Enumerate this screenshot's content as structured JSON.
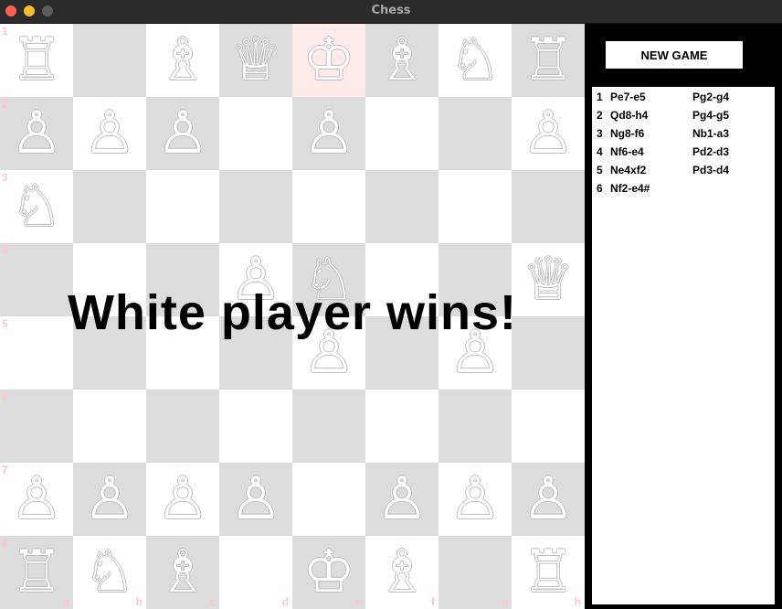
{
  "window": {
    "title": "Chess"
  },
  "board": {
    "rank_labels": [
      "1",
      "2",
      "3",
      "4",
      "5",
      "6",
      "7",
      "8"
    ],
    "file_labels": [
      "a",
      "b",
      "c",
      "d",
      "e",
      "f",
      "g",
      "h"
    ],
    "check_square": [
      0,
      4
    ],
    "pieces": [
      {
        "row": 0,
        "col": 0,
        "piece": "rook",
        "color": "black"
      },
      {
        "row": 0,
        "col": 2,
        "piece": "bishop",
        "color": "black"
      },
      {
        "row": 0,
        "col": 3,
        "piece": "queen",
        "color": "black"
      },
      {
        "row": 0,
        "col": 4,
        "piece": "king",
        "color": "black"
      },
      {
        "row": 0,
        "col": 5,
        "piece": "bishop",
        "color": "black"
      },
      {
        "row": 0,
        "col": 6,
        "piece": "knight",
        "color": "black"
      },
      {
        "row": 0,
        "col": 7,
        "piece": "rook",
        "color": "black"
      },
      {
        "row": 1,
        "col": 0,
        "piece": "pawn",
        "color": "black"
      },
      {
        "row": 1,
        "col": 1,
        "piece": "pawn",
        "color": "black"
      },
      {
        "row": 1,
        "col": 2,
        "piece": "pawn",
        "color": "black"
      },
      {
        "row": 1,
        "col": 4,
        "piece": "pawn",
        "color": "black"
      },
      {
        "row": 1,
        "col": 7,
        "piece": "pawn",
        "color": "black"
      },
      {
        "row": 2,
        "col": 0,
        "piece": "knight",
        "color": "white"
      },
      {
        "row": 3,
        "col": 3,
        "piece": "pawn",
        "color": "black"
      },
      {
        "row": 3,
        "col": 4,
        "piece": "knight",
        "color": "white"
      },
      {
        "row": 3,
        "col": 7,
        "piece": "queen",
        "color": "black"
      },
      {
        "row": 4,
        "col": 4,
        "piece": "pawn",
        "color": "black"
      },
      {
        "row": 4,
        "col": 6,
        "piece": "pawn",
        "color": "white"
      },
      {
        "row": 6,
        "col": 0,
        "piece": "pawn",
        "color": "white"
      },
      {
        "row": 6,
        "col": 1,
        "piece": "pawn",
        "color": "white"
      },
      {
        "row": 6,
        "col": 2,
        "piece": "pawn",
        "color": "white"
      },
      {
        "row": 6,
        "col": 3,
        "piece": "pawn",
        "color": "white"
      },
      {
        "row": 6,
        "col": 5,
        "piece": "pawn",
        "color": "white"
      },
      {
        "row": 6,
        "col": 6,
        "piece": "pawn",
        "color": "white"
      },
      {
        "row": 6,
        "col": 7,
        "piece": "pawn",
        "color": "white"
      },
      {
        "row": 7,
        "col": 0,
        "piece": "rook",
        "color": "white"
      },
      {
        "row": 7,
        "col": 1,
        "piece": "knight",
        "color": "white"
      },
      {
        "row": 7,
        "col": 2,
        "piece": "bishop",
        "color": "white"
      },
      {
        "row": 7,
        "col": 4,
        "piece": "king",
        "color": "white"
      },
      {
        "row": 7,
        "col": 5,
        "piece": "bishop",
        "color": "white"
      },
      {
        "row": 7,
        "col": 7,
        "piece": "rook",
        "color": "white"
      }
    ]
  },
  "sidebar": {
    "new_game_label": "NEW GAME",
    "moves": [
      {
        "num": "1",
        "white": "Pe7-e5",
        "black": "Pg2-g4"
      },
      {
        "num": "2",
        "white": "Qd8-h4",
        "black": "Pg4-g5"
      },
      {
        "num": "3",
        "white": "Ng8-f6",
        "black": "Nb1-a3"
      },
      {
        "num": "4",
        "white": "Nf6-e4",
        "black": "Pd2-d3"
      },
      {
        "num": "5",
        "white": "Ne4xf2",
        "black": "Pd3-d4"
      },
      {
        "num": "6",
        "white": "Nf2-e4#",
        "black": ""
      }
    ]
  },
  "result": {
    "message": "White player wins!"
  },
  "colors": {
    "light_square": "#ffffff",
    "dark_square": "#dcdcdc",
    "check_square": "#ffe9e9",
    "coordinate_label": "#ffc7c7",
    "titlebar": "#2b2b2b"
  }
}
